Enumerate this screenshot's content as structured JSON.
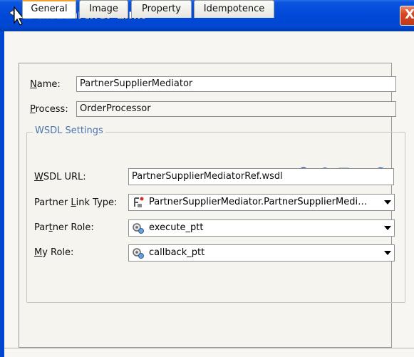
{
  "window": {
    "title": "Edit Partner Link",
    "close_glyph": "X"
  },
  "tabs": [
    {
      "label": "General",
      "active": true
    },
    {
      "label": "Image",
      "active": false
    },
    {
      "label": "Property",
      "active": false
    },
    {
      "label": "Idempotence",
      "active": false
    }
  ],
  "general": {
    "name_label_u": "N",
    "name_label_rest": "ame:",
    "name_value": "PartnerSupplierMediator",
    "process_label_u": "P",
    "process_label_rest": "rocess:",
    "process_value": "OrderProcessor"
  },
  "wsdl": {
    "group_title": "WSDL Settings",
    "toolbar_icons": [
      "search-icon",
      "browse-service-icon",
      "service-explorer-icon",
      "refresh-icon"
    ],
    "url_label_u": "W",
    "url_label_rest": "SDL URL:",
    "url_value": "PartnerSupplierMediatorRef.wsdl",
    "plt_label_pre": "Partner ",
    "plt_label_u": "L",
    "plt_label_rest": "ink Type:",
    "plt_value": "PartnerSupplierMediator.PartnerSupplierMedi…",
    "role_label_pre": "Par",
    "role_label_u": "t",
    "role_label_rest": "ner Role:",
    "role_value": "execute_ptt",
    "myrole_label_u": "M",
    "myrole_label_rest": "y Role:",
    "myrole_value": "callback_ptt"
  },
  "colors": {
    "title_bar": "#0047d0",
    "active_tab_accent": "#f0a030",
    "group_title": "#4a74b0"
  }
}
